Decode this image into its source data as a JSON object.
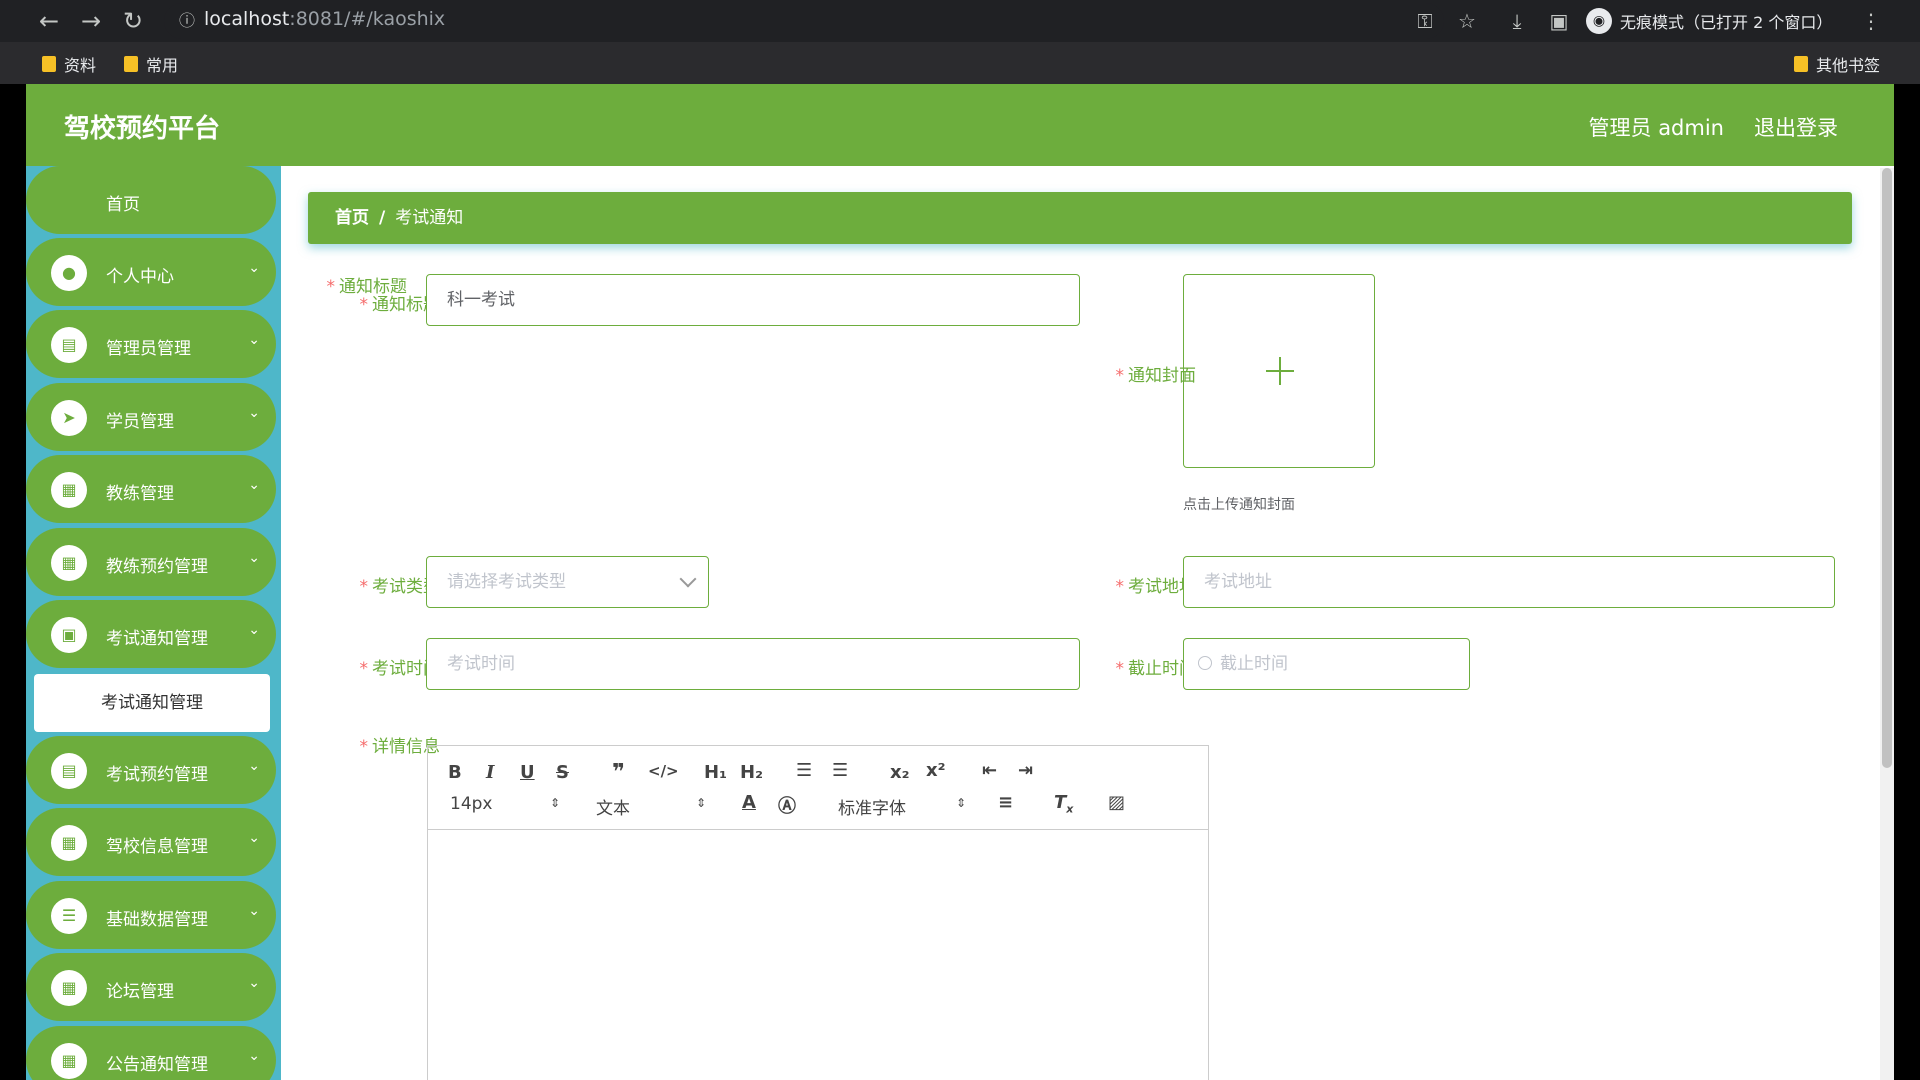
{
  "browser": {
    "url_host": "localhost",
    "url_path": ":8081/#/kaoshix",
    "incognito_label": "无痕模式（已打开 2 个窗口）",
    "bookmarks": [
      "资料",
      "常用"
    ],
    "other_bookmarks": "其他书签"
  },
  "header": {
    "title": "驾校预约平台",
    "admin_label": "管理员 admin",
    "logout": "退出登录"
  },
  "sidebar": {
    "home": "首页",
    "items": [
      {
        "label": "个人中心",
        "icon": "user-icon"
      },
      {
        "label": "管理员管理",
        "icon": "clipboard-icon"
      },
      {
        "label": "学员管理",
        "icon": "send-icon"
      },
      {
        "label": "教练管理",
        "icon": "grid-icon"
      },
      {
        "label": "教练预约管理",
        "icon": "grid-icon"
      },
      {
        "label": "考试通知管理",
        "icon": "briefcase-icon"
      },
      {
        "label": "考试预约管理",
        "icon": "document-icon"
      },
      {
        "label": "驾校信息管理",
        "icon": "grid-icon"
      },
      {
        "label": "基础数据管理",
        "icon": "sliders-icon"
      },
      {
        "label": "论坛管理",
        "icon": "grid-icon"
      },
      {
        "label": "公告通知管理",
        "icon": "grid-icon"
      }
    ],
    "active_sub": "考试通知管理"
  },
  "breadcrumb": {
    "home": "首页",
    "sep": "/",
    "current": "考试通知"
  },
  "form": {
    "title_label": "通知标题",
    "title_value": "科一考试",
    "cover_label": "通知封面",
    "cover_tip": "点击上传通知封面",
    "type_label": "考试类型",
    "type_placeholder": "请选择考试类型",
    "address_label": "考试地址",
    "address_placeholder": "考试地址",
    "time_label": "考试时间",
    "time_placeholder": "考试时间",
    "deadline_label": "截止时间",
    "deadline_placeholder": "截止时间",
    "detail_label": "详情信息"
  },
  "editor": {
    "font_size": "14px",
    "header_select": "文本",
    "font_family": "标准字体"
  },
  "colors": {
    "green": "#6dad3d",
    "teal": "#4eb7c9"
  }
}
